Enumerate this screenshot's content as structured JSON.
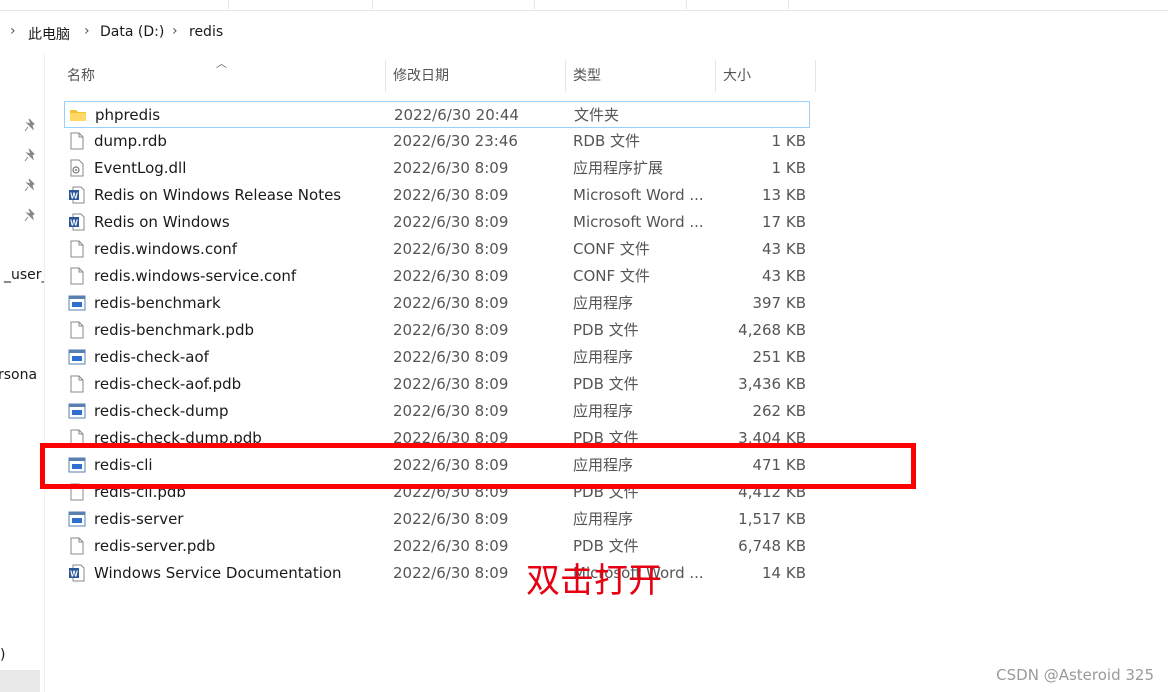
{
  "breadcrumb": {
    "items": [
      "此电脑",
      "Data (D:)",
      "redis"
    ]
  },
  "columns": {
    "name": "名称",
    "date": "修改日期",
    "type": "类型",
    "size": "大小"
  },
  "nav": {
    "items": [
      "_user_",
      "rsona",
      ")"
    ]
  },
  "files": [
    {
      "name": "phpredis",
      "date": "2022/6/30 20:44",
      "type": "文件夹",
      "size": "",
      "icon": "folder-icon",
      "selected": true
    },
    {
      "name": "dump.rdb",
      "date": "2022/6/30 23:46",
      "type": "RDB 文件",
      "size": "1 KB",
      "icon": "file-icon"
    },
    {
      "name": "EventLog.dll",
      "date": "2022/6/30 8:09",
      "type": "应用程序扩展",
      "size": "1 KB",
      "icon": "dll-icon"
    },
    {
      "name": "Redis on Windows Release Notes",
      "date": "2022/6/30 8:09",
      "type": "Microsoft Word ...",
      "size": "13 KB",
      "icon": "word-icon"
    },
    {
      "name": "Redis on Windows",
      "date": "2022/6/30 8:09",
      "type": "Microsoft Word ...",
      "size": "17 KB",
      "icon": "word-icon"
    },
    {
      "name": "redis.windows.conf",
      "date": "2022/6/30 8:09",
      "type": "CONF 文件",
      "size": "43 KB",
      "icon": "file-icon"
    },
    {
      "name": "redis.windows-service.conf",
      "date": "2022/6/30 8:09",
      "type": "CONF 文件",
      "size": "43 KB",
      "icon": "file-icon"
    },
    {
      "name": "redis-benchmark",
      "date": "2022/6/30 8:09",
      "type": "应用程序",
      "size": "397 KB",
      "icon": "exe-icon"
    },
    {
      "name": "redis-benchmark.pdb",
      "date": "2022/6/30 8:09",
      "type": "PDB 文件",
      "size": "4,268 KB",
      "icon": "file-icon"
    },
    {
      "name": "redis-check-aof",
      "date": "2022/6/30 8:09",
      "type": "应用程序",
      "size": "251 KB",
      "icon": "exe-icon"
    },
    {
      "name": "redis-check-aof.pdb",
      "date": "2022/6/30 8:09",
      "type": "PDB 文件",
      "size": "3,436 KB",
      "icon": "file-icon"
    },
    {
      "name": "redis-check-dump",
      "date": "2022/6/30 8:09",
      "type": "应用程序",
      "size": "262 KB",
      "icon": "exe-icon"
    },
    {
      "name": "redis-check-dump.pdb",
      "date": "2022/6/30 8:09",
      "type": "PDB 文件",
      "size": "3,404 KB",
      "icon": "file-icon"
    },
    {
      "name": "redis-cli",
      "date": "2022/6/30 8:09",
      "type": "应用程序",
      "size": "471 KB",
      "icon": "exe-icon"
    },
    {
      "name": "redis-cli.pdb",
      "date": "2022/6/30 8:09",
      "type": "PDB 文件",
      "size": "4,412 KB",
      "icon": "file-icon"
    },
    {
      "name": "redis-server",
      "date": "2022/6/30 8:09",
      "type": "应用程序",
      "size": "1,517 KB",
      "icon": "exe-icon"
    },
    {
      "name": "redis-server.pdb",
      "date": "2022/6/30 8:09",
      "type": "PDB 文件",
      "size": "6,748 KB",
      "icon": "file-icon"
    },
    {
      "name": "Windows Service Documentation",
      "date": "2022/6/30 8:09",
      "type": "Microsoft Word ...",
      "size": "14 KB",
      "icon": "word-icon"
    }
  ],
  "annotation": {
    "text": "双击打开",
    "color": "#e60012"
  },
  "highlight": {
    "target": "redis-cli",
    "color": "#ff0000"
  },
  "watermark": {
    "text": "CSDN @Asteroid 325"
  }
}
